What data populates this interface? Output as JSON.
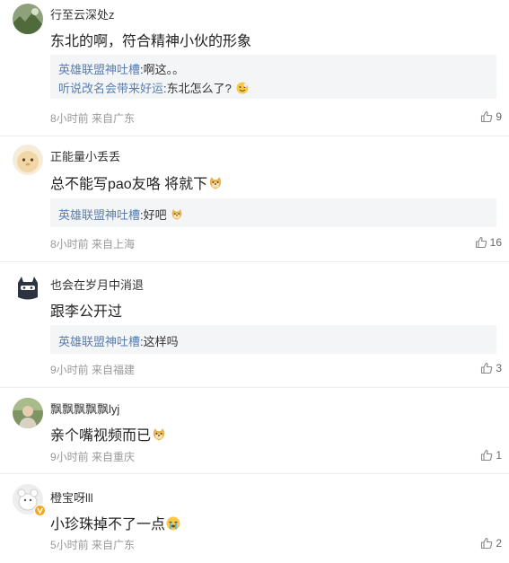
{
  "comments": [
    {
      "username": "行至云深处z",
      "content": "东北的啊，符合精神小伙的形象",
      "replies": [
        {
          "name": "英雄联盟神吐槽",
          "text": "啊这。。"
        },
        {
          "name": "听说改名会带来好运",
          "text": "东北怎么了?"
        }
      ],
      "time": "8小时前",
      "location": "来自广东",
      "likes": "9"
    },
    {
      "username": "正能量小丢丢",
      "content": "总不能写pao友咯 将就下",
      "replies": [
        {
          "name": "英雄联盟神吐槽",
          "text": "好吧"
        }
      ],
      "time": "8小时前",
      "location": "来自上海",
      "likes": "16"
    },
    {
      "username": "也会在岁月中消退",
      "content": "跟李公开过",
      "replies": [
        {
          "name": "英雄联盟神吐槽",
          "text": "这样吗"
        }
      ],
      "time": "9小时前",
      "location": "来自福建",
      "likes": "3"
    },
    {
      "username": "飘飘飘飘飘lyj",
      "content": "亲个嘴视频而已",
      "replies": [],
      "time": "9小时前",
      "location": "来自重庆",
      "likes": "1"
    },
    {
      "username": "橙宝呀lll",
      "content": "小珍珠掉不了一点",
      "replies": [],
      "time": "5小时前",
      "location": "来自广东",
      "likes": "2"
    }
  ],
  "icons": {
    "like": "thumbs-up-icon",
    "verified": "verified-badge-icon"
  },
  "colors": {
    "reply_name": "#5a7eb0",
    "reply_box": "#f4f5f7",
    "meta": "#999999",
    "verified_badge": "#f5a623"
  }
}
